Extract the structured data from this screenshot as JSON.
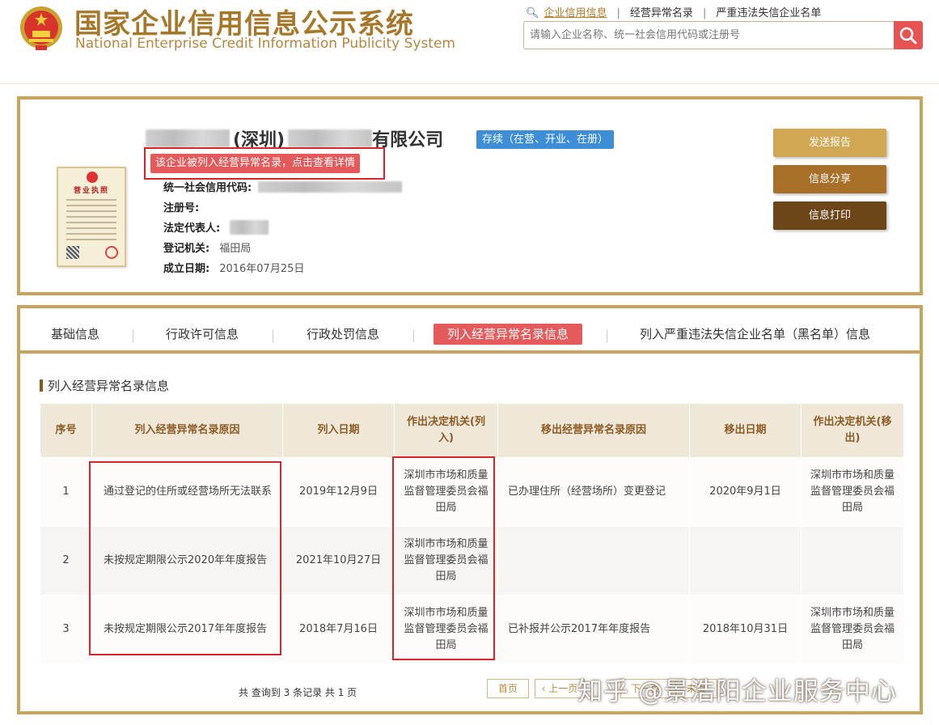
{
  "header": {
    "title_cn": "国家企业信用信息公示系统",
    "title_en": "National Enterprise Credit Information Publicity System",
    "nav": [
      "企业信用信息",
      "经营异常名录",
      "严重违法失信企业名单"
    ],
    "search_placeholder": "请输入企业名称、统一社会信用代码或注册号"
  },
  "company": {
    "name_part1": "(深圳)",
    "name_part2": "有限公司",
    "status": "存续（在营、开业、在册）",
    "alert": "该企业被列入经营异常名录，点击查看详情",
    "fields": [
      {
        "label": "统一社会信用代码:",
        "value": ""
      },
      {
        "label": "注册号:",
        "value": ""
      },
      {
        "label": "法定代表人:",
        "value": ""
      },
      {
        "label": "登记机关:",
        "value": "福田局"
      },
      {
        "label": "成立日期:",
        "value": "2016年07月25日"
      }
    ],
    "license_title": "营业执照"
  },
  "actions": [
    "发送报告",
    "信息分享",
    "信息打印"
  ],
  "tabs": [
    "基础信息",
    "行政许可信息",
    "行政处罚信息",
    "列入经营异常名录信息",
    "列入严重违法失信企业名单（黑名单）信息"
  ],
  "section_title": "列入经营异常名录信息",
  "table": {
    "headers": [
      "序号",
      "列入经营异常名录原因",
      "列入日期",
      "作出决定机关(列入)",
      "移出经营异常名录原因",
      "移出日期",
      "作出决定机关(移出)"
    ],
    "rows": [
      [
        "1",
        "通过登记的住所或经营场所无法联系",
        "2019年12月9日",
        "深圳市市场和质量监督管理委员会福田局",
        "已办理住所（经营场所）变更登记",
        "2020年9月1日",
        "深圳市市场和质量监督管理委员会福田局"
      ],
      [
        "2",
        "未按规定期限公示2020年年度报告",
        "2021年10月27日",
        "深圳市市场和质量监督管理委员会福田局",
        "",
        "",
        ""
      ],
      [
        "3",
        "未按规定期限公示2017年年度报告",
        "2018年7月16日",
        "深圳市市场和质量监督管理委员会福田局",
        "已补报并公示2017年年度报告",
        "2018年10月31日",
        "深圳市市场和质量监督管理委员会福田局"
      ]
    ]
  },
  "pager": {
    "info": "共 查询到 3 条记录 共 1 页",
    "first": "首页",
    "prev": "上一页",
    "next": "下一页",
    "last": "末页"
  },
  "watermark": "知乎 @景浩阳企业服务中心",
  "colors": {
    "gold": "#c9a45d",
    "red": "#e55452",
    "blue": "#3d8ed6",
    "btn1": "#d0a752",
    "btn2": "#a86f28",
    "btn3": "#6c4518"
  }
}
